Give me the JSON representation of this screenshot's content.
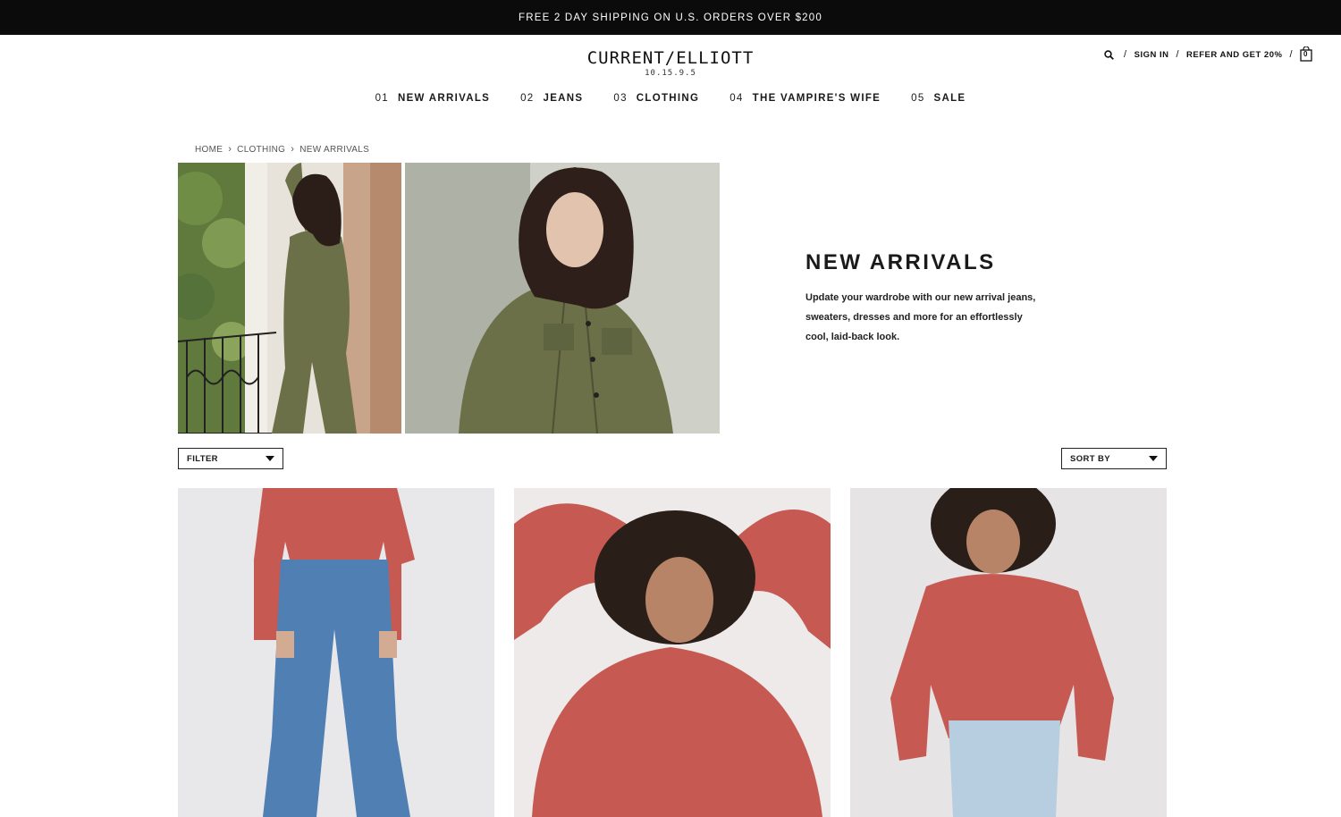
{
  "promo": {
    "text": "FREE 2 DAY SHIPPING ON U.S. ORDERS OVER $200"
  },
  "brand": {
    "name": "CURRENT/ELLIOTT",
    "tagline": "10.15.9.5"
  },
  "utility": {
    "search_icon": "search-icon",
    "sign_in": "SIGN IN",
    "refer": "REFER AND GET 20%",
    "bag_icon": "shopping-bag-icon",
    "bag_count": "0",
    "separator": "/"
  },
  "nav": [
    {
      "num": "01",
      "label": "NEW ARRIVALS"
    },
    {
      "num": "02",
      "label": "JEANS"
    },
    {
      "num": "03",
      "label": "CLOTHING"
    },
    {
      "num": "04",
      "label": "THE VAMPIRE'S WIFE"
    },
    {
      "num": "05",
      "label": "SALE"
    }
  ],
  "breadcrumb": [
    "HOME",
    "CLOTHING",
    "NEW ARRIVALS"
  ],
  "hero": {
    "title": "NEW ARRIVALS",
    "description": "Update your wardrobe with our new arrival jeans, sweaters, dresses and more for an effortlessly cool, laid-back look."
  },
  "controls": {
    "filter": "FILTER",
    "sort": "SORT BY"
  },
  "colors": {
    "promo_bg": "#0b0b0b",
    "olive": "#6b7048",
    "sweater": "#c65a52",
    "denim": "#4f7fb3"
  }
}
